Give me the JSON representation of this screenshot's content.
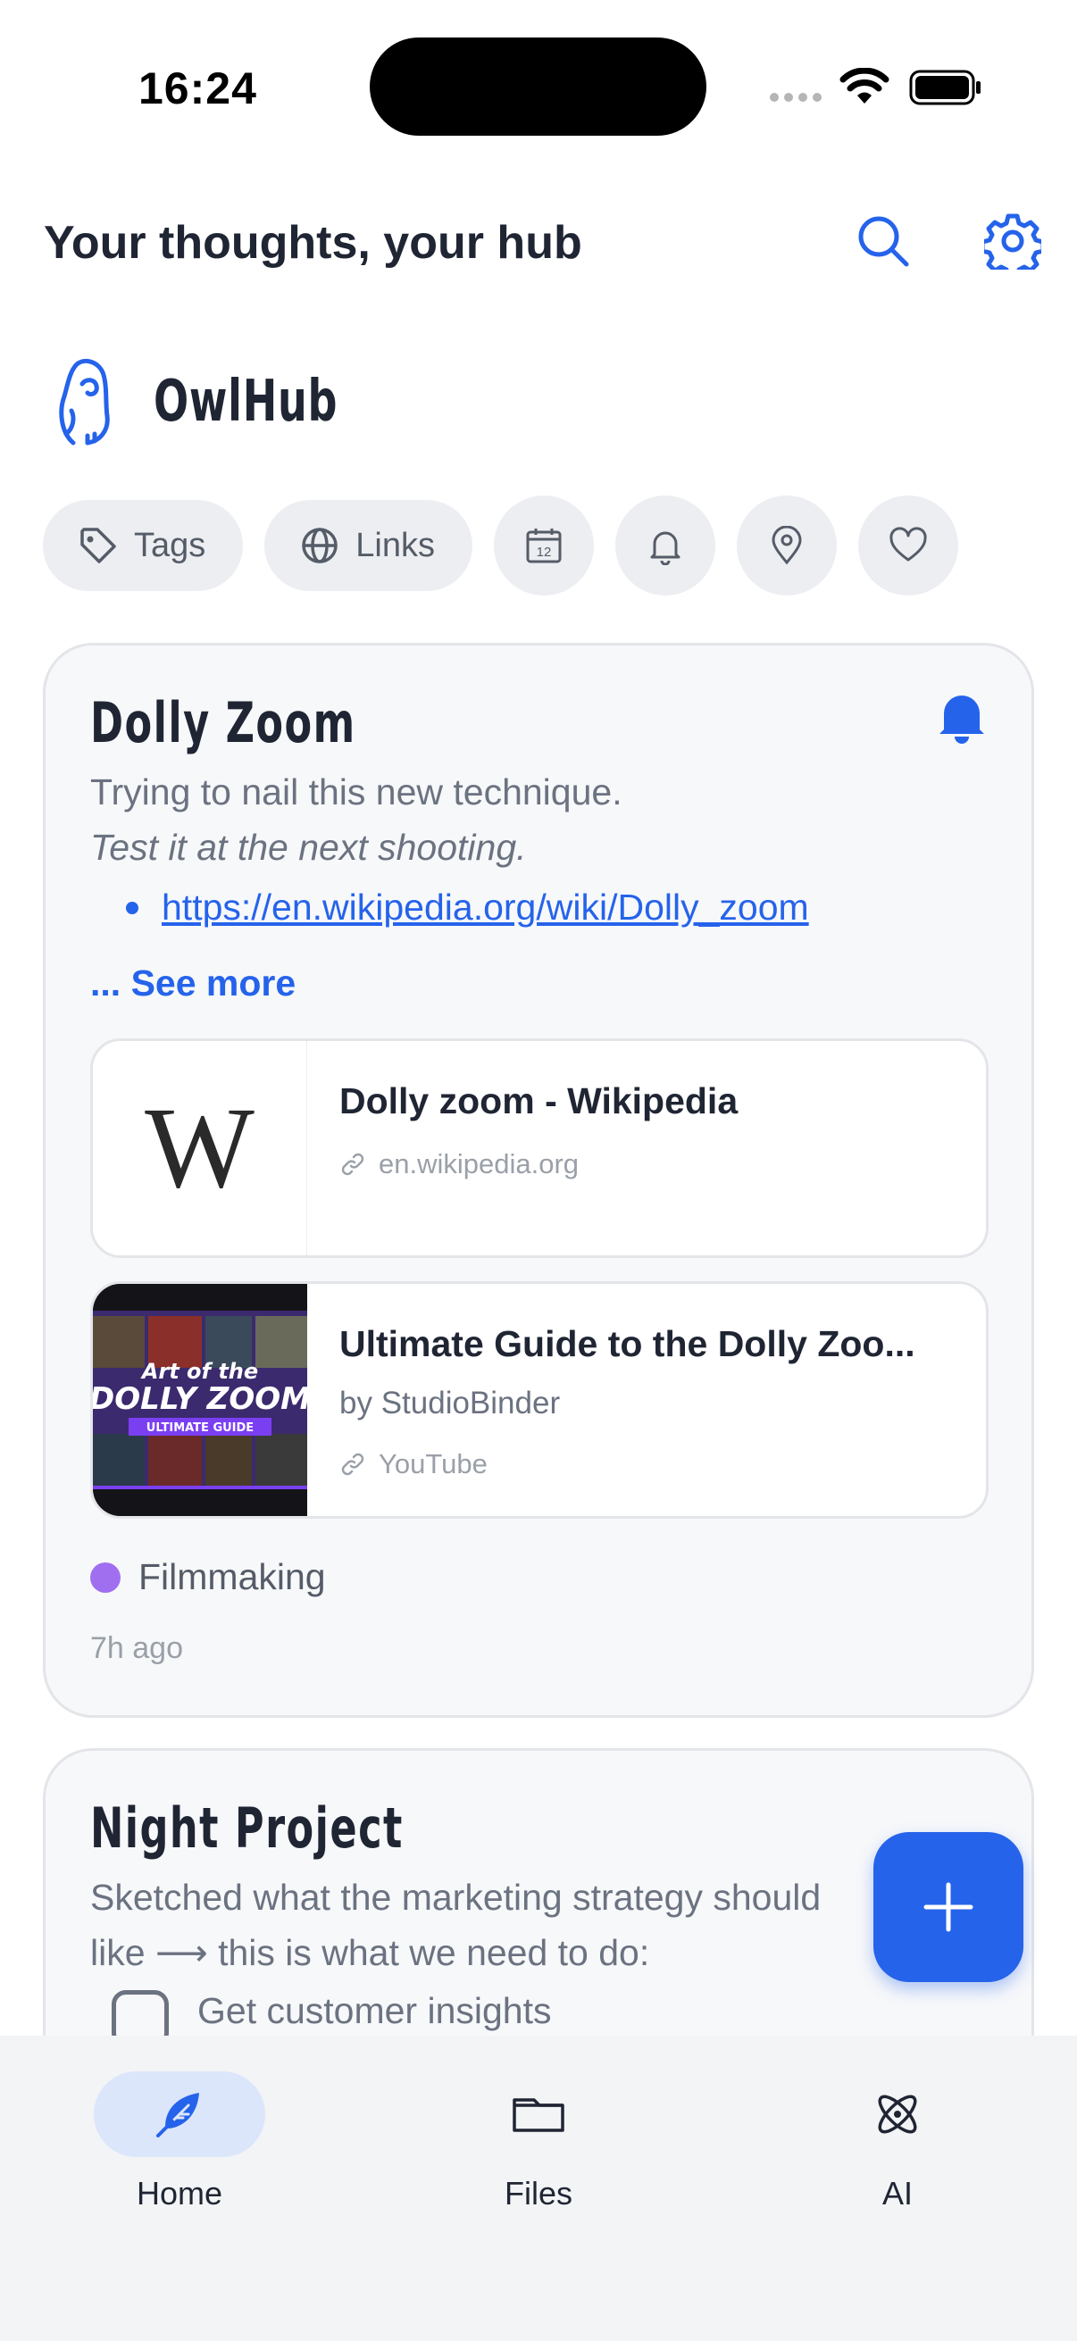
{
  "status_bar": {
    "time": "16:24"
  },
  "header": {
    "title": "Your thoughts, your hub",
    "search_icon": "search-icon",
    "settings_icon": "gear-icon"
  },
  "brand": {
    "name": "OwlHub",
    "logo_icon": "owl-icon"
  },
  "filters": {
    "tags_label": "Tags",
    "links_label": "Links",
    "icons": [
      "calendar-icon",
      "bell-icon",
      "location-pin-icon",
      "heart-icon"
    ]
  },
  "notes": [
    {
      "title": "Dolly Zoom",
      "line1": "Trying to nail this new technique.",
      "line2": "Test it at the next shooting.",
      "link": "https://en.wikipedia.org/wiki/Dolly_zoom",
      "see_more": "... See more",
      "link_cards": [
        {
          "title": "Dolly zoom - Wikipedia",
          "domain": "en.wikipedia.org",
          "thumb_letter": "W"
        },
        {
          "title": "Ultimate Guide to the Dolly Zoo...",
          "subtitle": "by StudioBinder",
          "domain": "YouTube",
          "thumb_line1": "Art of the",
          "thumb_line2": "DOLLY ZOOM",
          "thumb_line3": "ULTIMATE GUIDE"
        }
      ],
      "tag": "Filmmaking",
      "age": "7h ago"
    },
    {
      "title": "Night Project",
      "line1": "Sketched what the marketing strategy should",
      "line2": "like ⟶ this is what we need to do:",
      "checklist_item": "Get customer insights"
    }
  ],
  "nav": {
    "home": "Home",
    "files": "Files",
    "ai": "AI"
  },
  "colors": {
    "accent": "#2563eb",
    "tag_dot": "#a06ff0",
    "nav_active_bg": "#dbe6fb"
  }
}
